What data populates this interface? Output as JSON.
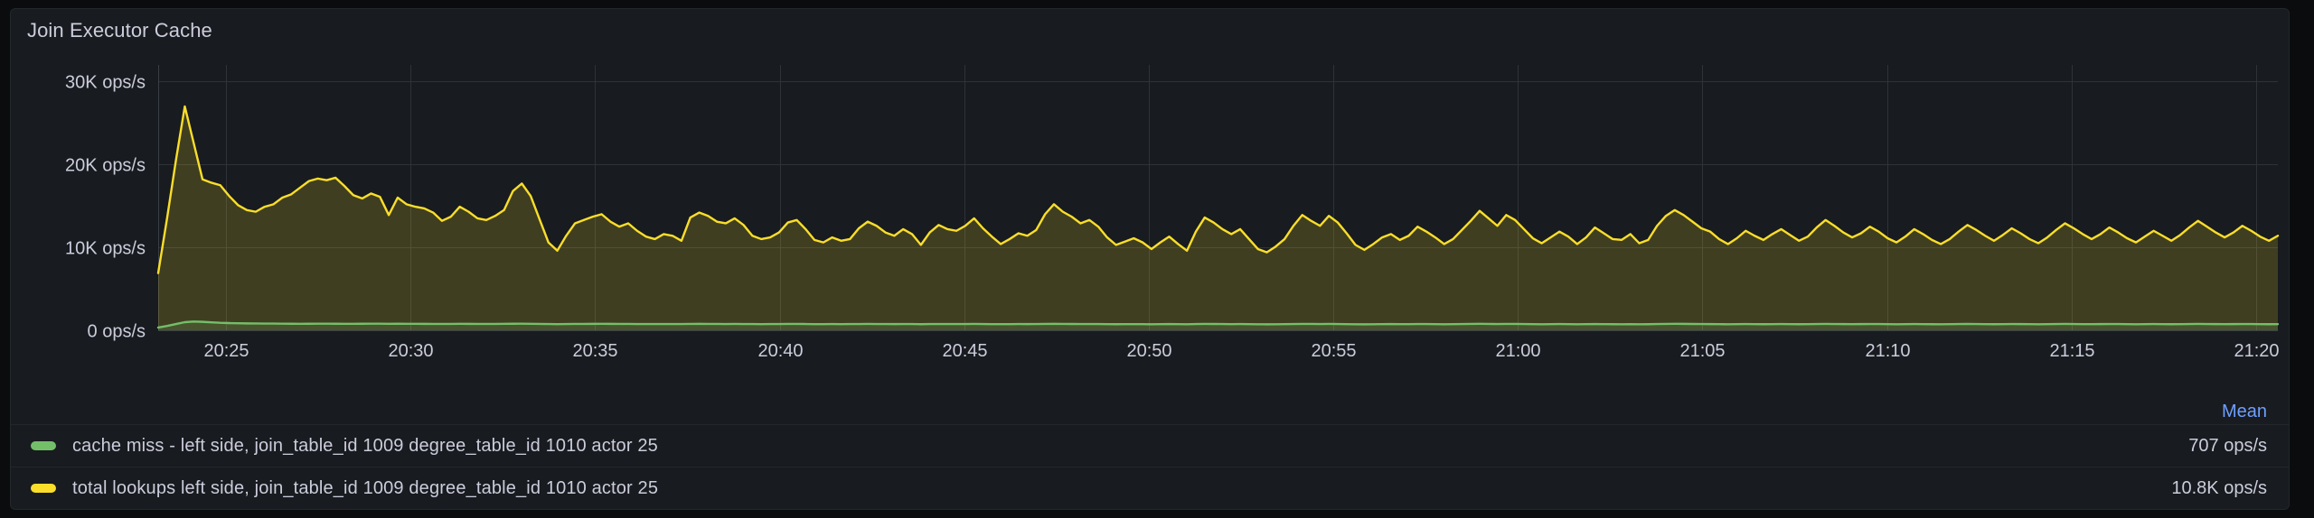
{
  "panel": {
    "title": "Join Executor Cache"
  },
  "legend": {
    "stat_header": "Mean",
    "items": [
      {
        "color": "#73bf69",
        "label": "cache miss - left side, join_table_id 1009 degree_table_id 1010 actor 25",
        "value": "707 ops/s"
      },
      {
        "color": "#fade2a",
        "label": "total lookups left side, join_table_id 1009 degree_table_id 1010 actor 25",
        "value": "10.8K ops/s"
      }
    ]
  },
  "chart_data": {
    "type": "area",
    "title": "Join Executor Cache",
    "xlabel": "",
    "ylabel": "ops/s",
    "grid": true,
    "legend_position": "bottom",
    "ylim": [
      0,
      32000
    ],
    "ytick_labels": [
      "30K ops/s",
      "20K ops/s",
      "10K ops/s",
      "0 ops/s"
    ],
    "ytick_values": [
      30000,
      20000,
      10000,
      0
    ],
    "xtick_labels": [
      "20:25",
      "20:30",
      "20:35",
      "20:40",
      "20:45",
      "20:50",
      "20:55",
      "21:00",
      "21:05",
      "21:10",
      "21:15",
      "21:20"
    ],
    "xlim": [
      "20:22",
      "21:20"
    ],
    "series": [
      {
        "name": "total lookups left side, join_table_id 1009 degree_table_id 1010 actor 25",
        "color": "#fade2a",
        "mean": 10800,
        "unit": "ops/s",
        "values": [
          6900,
          13500,
          20500,
          27000,
          22600,
          18200,
          17800,
          17500,
          16200,
          15100,
          14500,
          14300,
          14900,
          15200,
          16000,
          16400,
          17200,
          18000,
          18300,
          18100,
          18400,
          17400,
          16300,
          15900,
          16500,
          16100,
          13900,
          16000,
          15200,
          14900,
          14700,
          14200,
          13200,
          13700,
          14900,
          14300,
          13500,
          13300,
          13800,
          14500,
          16800,
          17700,
          16200,
          13400,
          10600,
          9600,
          11400,
          12900,
          13300,
          13700,
          14000,
          13100,
          12500,
          12900,
          12000,
          11300,
          11000,
          11600,
          11400,
          10800,
          13600,
          14200,
          13800,
          13100,
          12900,
          13500,
          12700,
          11400,
          11000,
          11200,
          11800,
          13000,
          13300,
          12200,
          10900,
          10600,
          11200,
          10800,
          11000,
          12300,
          13100,
          12600,
          11800,
          11400,
          12200,
          11600,
          10300,
          11800,
          12700,
          12200,
          12000,
          12600,
          13500,
          12300,
          11300,
          10400,
          11000,
          11700,
          11400,
          12100,
          14000,
          15200,
          14300,
          13700,
          12900,
          13300,
          12500,
          11200,
          10300,
          10700,
          11100,
          10600,
          9800,
          10600,
          11300,
          10400,
          9600,
          11900,
          13600,
          13000,
          12200,
          11600,
          12200,
          11000,
          9800,
          9400,
          10100,
          11000,
          12600,
          13900,
          13200,
          12600,
          13800,
          13000,
          11700,
          10300,
          9700,
          10400,
          11200,
          11600,
          10900,
          11400,
          12500,
          11900,
          11200,
          10400,
          11000,
          12100,
          13200,
          14400,
          13500,
          12600,
          13900,
          13300,
          12200,
          11100,
          10500,
          11200,
          11900,
          11300,
          10400,
          11200,
          12400,
          11700,
          11000,
          10900,
          11600,
          10500,
          10900,
          12600,
          13800,
          14500,
          13900,
          13100,
          12300,
          11900,
          11000,
          10400,
          11100,
          12000,
          11400,
          10900,
          11600,
          12200,
          11500,
          10800,
          11300,
          12400,
          13300,
          12600,
          11800,
          11200,
          11700,
          12500,
          11900,
          11100,
          10600,
          11300,
          12200,
          11600,
          10900,
          10400,
          11000,
          11900,
          12700,
          12100,
          11400,
          10800,
          11500,
          12300,
          11700,
          11000,
          10500,
          11200,
          12100,
          12900,
          12300,
          11600,
          11000,
          11600,
          12400,
          11800,
          11100,
          10600,
          11300,
          12000,
          11400,
          10800,
          11500,
          12400,
          13200,
          12500,
          11800,
          11200,
          11800,
          12600,
          12000,
          11300,
          10800,
          11400
        ]
      },
      {
        "name": "cache miss - left side, join_table_id 1009 degree_table_id 1010 actor 25",
        "color": "#73bf69",
        "mean": 707,
        "unit": "ops/s",
        "values": [
          330,
          520,
          760,
          980,
          1050,
          1020,
          960,
          900,
          870,
          850,
          830,
          820,
          810,
          805,
          800,
          790,
          785,
          790,
          800,
          795,
          790,
          785,
          780,
          790,
          800,
          795,
          780,
          790,
          785,
          780,
          775,
          770,
          765,
          770,
          780,
          775,
          770,
          765,
          770,
          780,
          790,
          795,
          785,
          770,
          750,
          740,
          755,
          765,
          770,
          775,
          780,
          775,
          765,
          770,
          760,
          755,
          750,
          760,
          755,
          750,
          770,
          775,
          770,
          765,
          760,
          765,
          760,
          750,
          745,
          750,
          755,
          765,
          770,
          760,
          745,
          740,
          750,
          745,
          750,
          760,
          765,
          760,
          752,
          748,
          755,
          750,
          735,
          750,
          760,
          755,
          752,
          757,
          765,
          755,
          745,
          738,
          745,
          752,
          748,
          755,
          768,
          775,
          770,
          762,
          755,
          760,
          752,
          742,
          735,
          740,
          745,
          740,
          730,
          740,
          748,
          738,
          728,
          752,
          768,
          762,
          752,
          745,
          752,
          740,
          728,
          722,
          732,
          742,
          760,
          770,
          765,
          755,
          768,
          760,
          745,
          730,
          722,
          732,
          742,
          748,
          738,
          745,
          758,
          750,
          740,
          730,
          740,
          752,
          765,
          778,
          768,
          755,
          772,
          765,
          750,
          738,
          730,
          740,
          750,
          742,
          730,
          740,
          755,
          745,
          735,
          732,
          742,
          728,
          735,
          758,
          772,
          782,
          775,
          762,
          752,
          748,
          738,
          728,
          738,
          750,
          742,
          735,
          745,
          755,
          745,
          735,
          742,
          755,
          768,
          758,
          748,
          740,
          748,
          758,
          750,
          740,
          732,
          742,
          752,
          745,
          735,
          728,
          738,
          750,
          762,
          752,
          742,
          735,
          745,
          755,
          748,
          738,
          730,
          740,
          752,
          765,
          755,
          745,
          738,
          748,
          758,
          750,
          740,
          732,
          742,
          752,
          745,
          735,
          745,
          758,
          768,
          758,
          748,
          740,
          748,
          760,
          752,
          742,
          735,
          745
        ]
      }
    ]
  }
}
